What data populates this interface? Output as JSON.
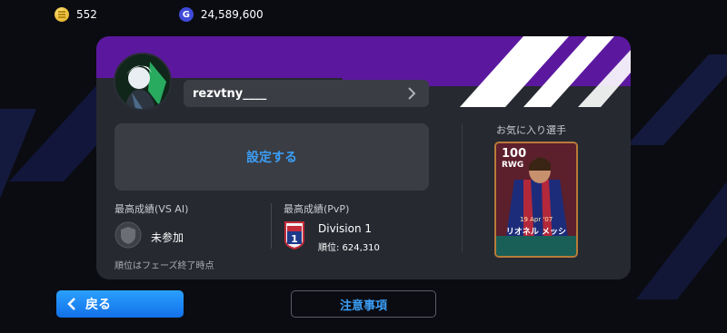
{
  "currency": {
    "coins": "552",
    "gp": "24,589,600",
    "gp_icon_glyph": "G"
  },
  "profile": {
    "username": "rezvtny____",
    "set_button_label": "設定する",
    "ai_section_label": "最高成績(VS AI)",
    "ai_status": "未参加",
    "ranking_note": "順位はフェーズ終了時点",
    "pvp_section_label": "最高成績(PvP)",
    "division_name": "Division 1",
    "division_badge_number": "1",
    "division_rank": "順位: 624,310",
    "favorite_label": "お気に入り選手"
  },
  "player_card": {
    "rating": "100",
    "position": "RWG",
    "date": "19 Apr '07",
    "name": "リオネル メッシ"
  },
  "footer": {
    "back_label": "戻る",
    "notes_label": "注意事項"
  },
  "colors": {
    "accent_blue": "#3b9ef5",
    "purple_band": "#5b189f",
    "card_bg": "#262930"
  }
}
